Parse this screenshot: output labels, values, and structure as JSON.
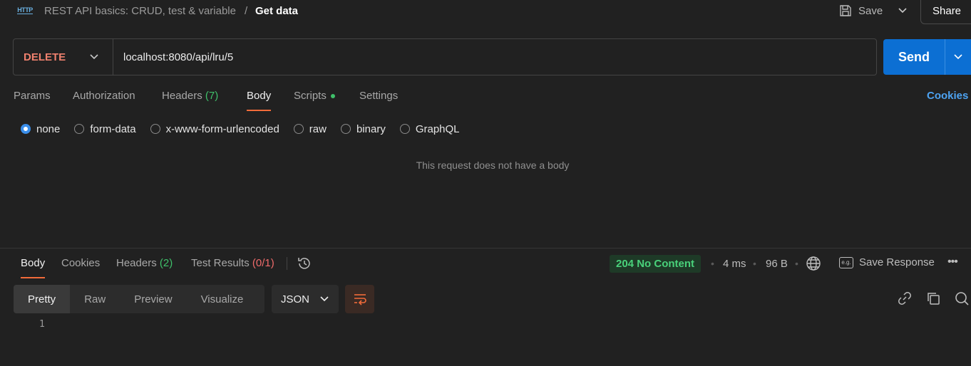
{
  "breadcrumb": {
    "icon": "http-icon",
    "icon_text": "HTTP",
    "parent": "REST API basics: CRUD, test & variable",
    "separator": "/",
    "current": "Get data"
  },
  "header": {
    "save_label": "Save",
    "share_label": "Share"
  },
  "request": {
    "method": "DELETE",
    "url": "localhost:8080/api/lru/5",
    "send_label": "Send"
  },
  "request_tabs": {
    "params": "Params",
    "authorization": "Authorization",
    "headers": "Headers",
    "headers_count": "(7)",
    "body": "Body",
    "scripts": "Scripts",
    "settings": "Settings",
    "active": "Body",
    "cookies": "Cookies"
  },
  "body_types": {
    "none": "none",
    "form_data": "form-data",
    "urlencoded": "x-www-form-urlencoded",
    "raw": "raw",
    "binary": "binary",
    "graphql": "GraphQL",
    "selected": "none"
  },
  "empty_body_message": "This request does not have a body",
  "response_tabs": {
    "body": "Body",
    "cookies": "Cookies",
    "headers": "Headers",
    "headers_count": "(2)",
    "test_results": "Test Results",
    "test_results_count": "(0/1)",
    "active": "Body"
  },
  "response_meta": {
    "status": "204 No Content",
    "time": "4 ms",
    "size": "96 B",
    "save_response": "Save Response",
    "eg_icon_text": "e.g."
  },
  "view_modes": {
    "pretty": "Pretty",
    "raw": "Raw",
    "preview": "Preview",
    "visualize": "Visualize",
    "active": "Pretty"
  },
  "format": "JSON",
  "editor": {
    "line_number": "1"
  },
  "colors": {
    "accent": "#f26b3a",
    "send": "#0c6fd3",
    "method_delete": "#f0816e",
    "status_ok": "#49d17a",
    "link": "#4da3f2"
  }
}
